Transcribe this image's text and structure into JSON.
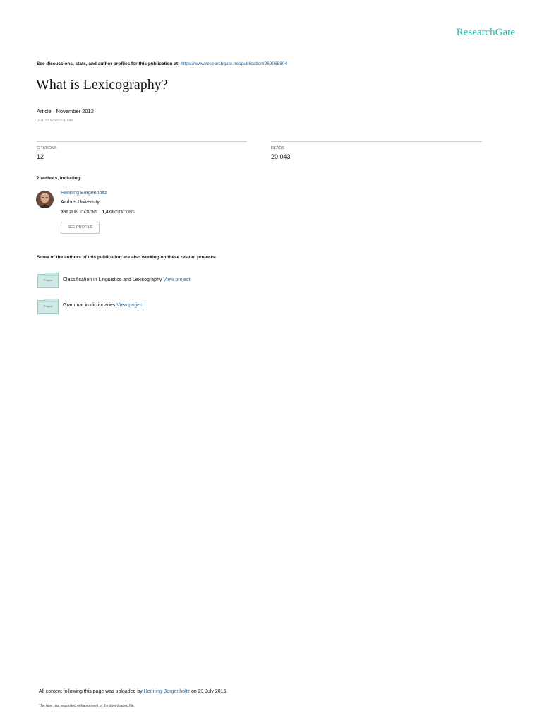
{
  "header": {
    "logo": "ResearchGate",
    "discussion_prefix": "See discussions, stats, and author profiles for this publication at: ",
    "publication_url": "https://www.researchgate.net/publication/269068804"
  },
  "article": {
    "title": "What is Lexicography?",
    "meta": "Article · November 2012",
    "doi": "DOI: 10.5788/22-1-996"
  },
  "stats": {
    "citations_label": "CITATIONS",
    "citations_value": "12",
    "reads_label": "READS",
    "reads_value": "20,043"
  },
  "authors": {
    "heading": "2 authors, including:",
    "items": [
      {
        "name": "Henning Bergenholtz",
        "affiliation": "Aarhus University",
        "publications_count": "360",
        "publications_label": "PUBLICATIONS",
        "citations_count": "1,478",
        "citations_label": "CITATIONS",
        "see_profile_label": "SEE PROFILE"
      }
    ]
  },
  "related": {
    "heading": "Some of the authors of this publication are also working on these related projects:",
    "folder_label": "Project",
    "projects": [
      {
        "title": "Classification in Linguistics and Lexicography",
        "link": "View project"
      },
      {
        "title": "Grammar in dictionaries",
        "link": "View project"
      }
    ]
  },
  "footer": {
    "uploaded_prefix": "All content following this page was uploaded by ",
    "uploader": "Henning Bergenholtz",
    "uploaded_suffix": " on 23 July 2015.",
    "enhancement_note": "The user has requested enhancement of the downloaded file."
  },
  "colors": {
    "brand": "#1fbfae",
    "link": "#2a6496",
    "folder": "#cfeae6"
  }
}
